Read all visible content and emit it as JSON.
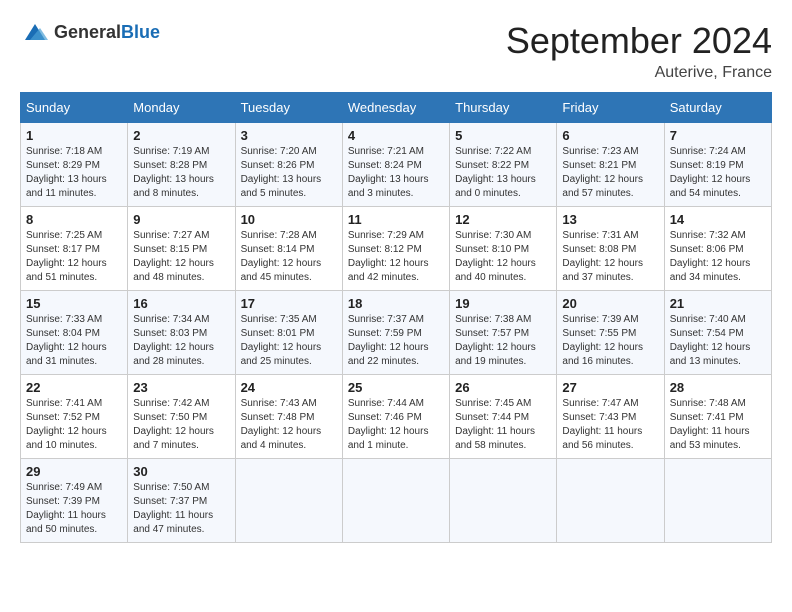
{
  "header": {
    "logo_general": "General",
    "logo_blue": "Blue",
    "title": "September 2024",
    "location": "Auterive, France"
  },
  "calendar": {
    "headers": [
      "Sunday",
      "Monday",
      "Tuesday",
      "Wednesday",
      "Thursday",
      "Friday",
      "Saturday"
    ],
    "weeks": [
      [
        {
          "day": "1",
          "sunrise": "7:18 AM",
          "sunset": "8:29 PM",
          "daylight": "13 hours and 11 minutes."
        },
        {
          "day": "2",
          "sunrise": "7:19 AM",
          "sunset": "8:28 PM",
          "daylight": "13 hours and 8 minutes."
        },
        {
          "day": "3",
          "sunrise": "7:20 AM",
          "sunset": "8:26 PM",
          "daylight": "13 hours and 5 minutes."
        },
        {
          "day": "4",
          "sunrise": "7:21 AM",
          "sunset": "8:24 PM",
          "daylight": "13 hours and 3 minutes."
        },
        {
          "day": "5",
          "sunrise": "7:22 AM",
          "sunset": "8:22 PM",
          "daylight": "13 hours and 0 minutes."
        },
        {
          "day": "6",
          "sunrise": "7:23 AM",
          "sunset": "8:21 PM",
          "daylight": "12 hours and 57 minutes."
        },
        {
          "day": "7",
          "sunrise": "7:24 AM",
          "sunset": "8:19 PM",
          "daylight": "12 hours and 54 minutes."
        }
      ],
      [
        {
          "day": "8",
          "sunrise": "7:25 AM",
          "sunset": "8:17 PM",
          "daylight": "12 hours and 51 minutes."
        },
        {
          "day": "9",
          "sunrise": "7:27 AM",
          "sunset": "8:15 PM",
          "daylight": "12 hours and 48 minutes."
        },
        {
          "day": "10",
          "sunrise": "7:28 AM",
          "sunset": "8:14 PM",
          "daylight": "12 hours and 45 minutes."
        },
        {
          "day": "11",
          "sunrise": "7:29 AM",
          "sunset": "8:12 PM",
          "daylight": "12 hours and 42 minutes."
        },
        {
          "day": "12",
          "sunrise": "7:30 AM",
          "sunset": "8:10 PM",
          "daylight": "12 hours and 40 minutes."
        },
        {
          "day": "13",
          "sunrise": "7:31 AM",
          "sunset": "8:08 PM",
          "daylight": "12 hours and 37 minutes."
        },
        {
          "day": "14",
          "sunrise": "7:32 AM",
          "sunset": "8:06 PM",
          "daylight": "12 hours and 34 minutes."
        }
      ],
      [
        {
          "day": "15",
          "sunrise": "7:33 AM",
          "sunset": "8:04 PM",
          "daylight": "12 hours and 31 minutes."
        },
        {
          "day": "16",
          "sunrise": "7:34 AM",
          "sunset": "8:03 PM",
          "daylight": "12 hours and 28 minutes."
        },
        {
          "day": "17",
          "sunrise": "7:35 AM",
          "sunset": "8:01 PM",
          "daylight": "12 hours and 25 minutes."
        },
        {
          "day": "18",
          "sunrise": "7:37 AM",
          "sunset": "7:59 PM",
          "daylight": "12 hours and 22 minutes."
        },
        {
          "day": "19",
          "sunrise": "7:38 AM",
          "sunset": "7:57 PM",
          "daylight": "12 hours and 19 minutes."
        },
        {
          "day": "20",
          "sunrise": "7:39 AM",
          "sunset": "7:55 PM",
          "daylight": "12 hours and 16 minutes."
        },
        {
          "day": "21",
          "sunrise": "7:40 AM",
          "sunset": "7:54 PM",
          "daylight": "12 hours and 13 minutes."
        }
      ],
      [
        {
          "day": "22",
          "sunrise": "7:41 AM",
          "sunset": "7:52 PM",
          "daylight": "12 hours and 10 minutes."
        },
        {
          "day": "23",
          "sunrise": "7:42 AM",
          "sunset": "7:50 PM",
          "daylight": "12 hours and 7 minutes."
        },
        {
          "day": "24",
          "sunrise": "7:43 AM",
          "sunset": "7:48 PM",
          "daylight": "12 hours and 4 minutes."
        },
        {
          "day": "25",
          "sunrise": "7:44 AM",
          "sunset": "7:46 PM",
          "daylight": "12 hours and 1 minute."
        },
        {
          "day": "26",
          "sunrise": "7:45 AM",
          "sunset": "7:44 PM",
          "daylight": "11 hours and 58 minutes."
        },
        {
          "day": "27",
          "sunrise": "7:47 AM",
          "sunset": "7:43 PM",
          "daylight": "11 hours and 56 minutes."
        },
        {
          "day": "28",
          "sunrise": "7:48 AM",
          "sunset": "7:41 PM",
          "daylight": "11 hours and 53 minutes."
        }
      ],
      [
        {
          "day": "29",
          "sunrise": "7:49 AM",
          "sunset": "7:39 PM",
          "daylight": "11 hours and 50 minutes."
        },
        {
          "day": "30",
          "sunrise": "7:50 AM",
          "sunset": "7:37 PM",
          "daylight": "11 hours and 47 minutes."
        },
        null,
        null,
        null,
        null,
        null
      ]
    ],
    "sunrise_label": "Sunrise: ",
    "sunset_label": "Sunset: ",
    "daylight_label": "Daylight: "
  }
}
